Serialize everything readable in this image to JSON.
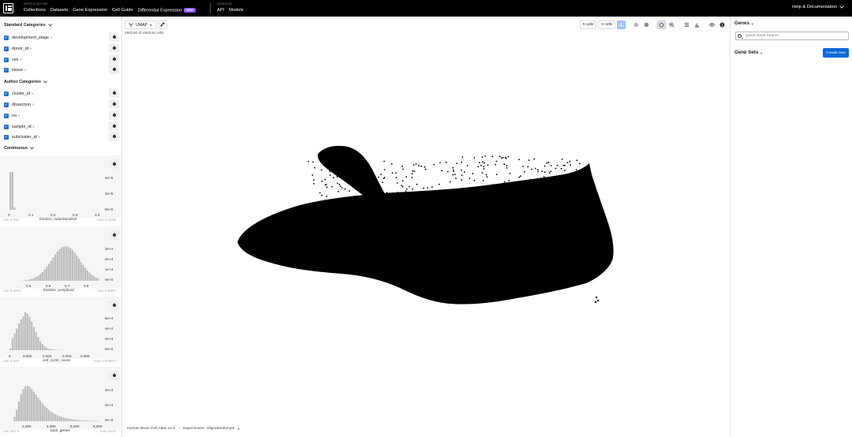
{
  "nav": {
    "application_heading": "APPLICATION",
    "links": [
      "Collections",
      "Datasets",
      "Gene Expression",
      "Cell Guide",
      "Differential Expression"
    ],
    "new_badge": "NEW",
    "census_heading": "CENSUS",
    "census_links": [
      "API",
      "Models"
    ],
    "help": "Help & Documentation"
  },
  "left_panel": {
    "standard_heading": "Standard Categories",
    "standard_items": [
      "development_stage",
      "donor_id",
      "sex",
      "tissue"
    ],
    "author_heading": "Author Categories",
    "author_items": [
      "cluster_id",
      "dissection",
      "roi",
      "sample_id",
      "subcluster_id"
    ],
    "continuous_heading": "Continuous",
    "histograms": [
      {
        "name": "fraction_mitochondrial",
        "min_label": "min 0.000",
        "max_label": "max 0.4185",
        "x_ticks": [
          "0",
          "0.1",
          "0.2",
          "0.3",
          "0.4"
        ],
        "y_ticks": [
          "4e+5",
          "2e+5",
          "0e+0"
        ]
      },
      {
        "name": "fraction_unspliced",
        "min_label": "min 0.4001",
        "max_label": "max 0.8807",
        "x_ticks": [
          "0.5",
          "0.6",
          "0.7",
          "0.8"
        ],
        "y_ticks": [
          "3e+4",
          "2e+4",
          "1e+4",
          "0e+0"
        ]
      },
      {
        "name": "cell_cycle_score",
        "min_label": "min 0.000",
        "max_label": "max 0.009677",
        "x_ticks": [
          "0",
          "0.002",
          "0.004",
          "0.006",
          "0.008"
        ],
        "y_ticks": [
          "6e+4",
          "4e+4",
          "2e+4",
          "0e+0"
        ]
      },
      {
        "name": "total_genes",
        "min_label": "min 481.0",
        "max_label": "max 8217",
        "x_ticks": [
          "2,000",
          "4,000",
          "6,000",
          "8,000"
        ],
        "y_ticks": [
          "4e+4",
          "2e+4",
          "0e+0"
        ]
      }
    ]
  },
  "center": {
    "embedding_label": "UMAP",
    "cell_count": "490246 of 490246 cells",
    "selection_a": "0 cells",
    "selection_b": "0 cells",
    "breadcrumb_dataset": "Human Brain Cell Atlas v1.0",
    "breadcrumb_filter": "Supercluster: Oligodendrocyte"
  },
  "right_panel": {
    "genes_heading": "Genes",
    "search_placeholder": "Quick Gene Search",
    "genesets_heading": "Gene Sets",
    "create_button": "Create new"
  },
  "colors": {
    "accent": "#0b68d9",
    "checkbox": "#2a6cd6",
    "badge": "#8f5cf7",
    "histogram_bar": "#bdbdbd",
    "scatter": "#000000"
  }
}
